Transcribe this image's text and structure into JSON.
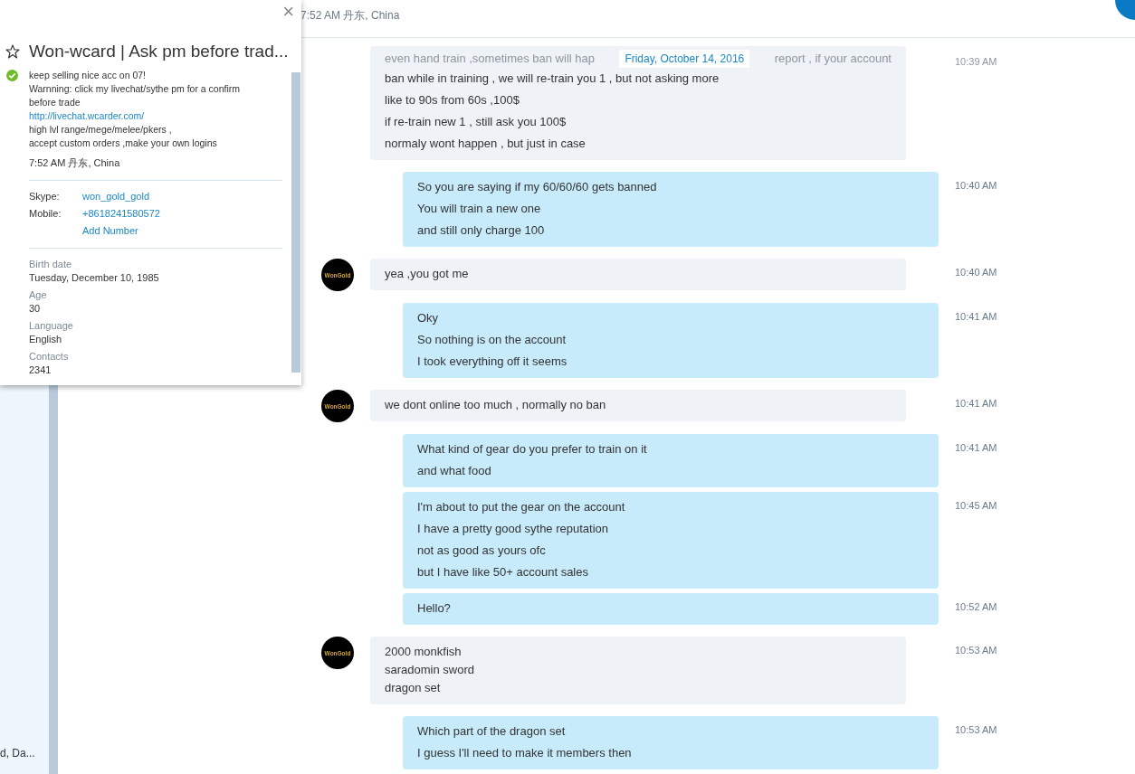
{
  "sidebar": {
    "items": [
      {
        "text": "d, Da..."
      }
    ]
  },
  "header": {
    "subtitle": "7:52 AM 丹东, China"
  },
  "date_divider": "Friday, October 14, 2016",
  "messages": [
    {
      "kind": "incoming",
      "faded": {
        "left": "even hand train ,sometimes ban will hap",
        "right": "report ,  if your account",
        "time": "10:39 AM"
      },
      "lines": [
        "ban while in training , we will re-train you 1 , but not asking more",
        "like to 90s from 60s ,100$",
        "if re-train new 1 , still ask you 100$",
        "normaly wont happen , but just in case"
      ]
    },
    {
      "kind": "outgoing",
      "time": "10:40 AM",
      "lines": [
        "So you are saying if my 60/60/60 gets banned",
        "You will train a new one",
        "and still only charge 100"
      ]
    },
    {
      "kind": "incoming",
      "time": "10:40 AM",
      "avatar": "WonGold",
      "lines": [
        "yea ,you got me"
      ]
    },
    {
      "kind": "outgoing",
      "time": "10:41 AM",
      "lines": [
        "Oky",
        "So nothing is on the account",
        "I took everything off it seems"
      ]
    },
    {
      "kind": "incoming",
      "time": "10:41 AM",
      "avatar": "WonGold",
      "lines": [
        "we dont online too much , normally no ban"
      ]
    },
    {
      "kind": "outgoing",
      "time": "10:41 AM",
      "lines": [
        "What kind of gear do you prefer to train on it",
        "and what food"
      ]
    },
    {
      "kind": "outgoing",
      "time": "10:45 AM",
      "lines": [
        "I'm about to put the gear on the account",
        "I have a pretty good sythe reputation",
        "not as good as yours ofc",
        "but I have like 50+ account sales"
      ]
    },
    {
      "kind": "outgoing",
      "time": "10:52 AM",
      "lines": [
        "Hello?"
      ]
    },
    {
      "kind": "incoming-compact",
      "time": "10:53 AM",
      "avatar": "WonGold",
      "lines": [
        "2000  monkfish",
        "saradomin sword",
        "dragon set"
      ]
    },
    {
      "kind": "outgoing",
      "time": "10:53 AM",
      "lines": [
        "Which part of the dragon set",
        "I guess I'll need to make it members then"
      ]
    }
  ],
  "profile": {
    "close": "×",
    "title": "Won-wcard | Ask pm before trad...",
    "favorite": false,
    "online": true,
    "mood": [
      {
        "kind": "text",
        "text": "keep selling nice acc on 07!"
      },
      {
        "kind": "text",
        "text": "Warnning: click my livechat/sythe pm for a confirm"
      },
      {
        "kind": "text",
        "text": "before trade"
      },
      {
        "kind": "link",
        "text": "http://livechat.wcarder.com/"
      },
      {
        "kind": "text",
        "text": "high lvl range/mege/melee/pkers ,"
      },
      {
        "kind": "text",
        "text": "accept custom orders ,make your own logins"
      }
    ],
    "local_time": "7:52 AM 丹东, China",
    "contacts": [
      {
        "label": "Skype:",
        "values": [
          "won_gold_gold"
        ]
      },
      {
        "label": "Mobile:",
        "values": [
          "+8618241580572",
          "Add Number"
        ]
      }
    ],
    "details": [
      {
        "label": "Birth date",
        "value": "Tuesday, December 10, 1985"
      },
      {
        "label": "Age",
        "value": "30"
      },
      {
        "label": "Language",
        "value": "English"
      },
      {
        "label": "Contacts",
        "value": "2341"
      }
    ]
  }
}
